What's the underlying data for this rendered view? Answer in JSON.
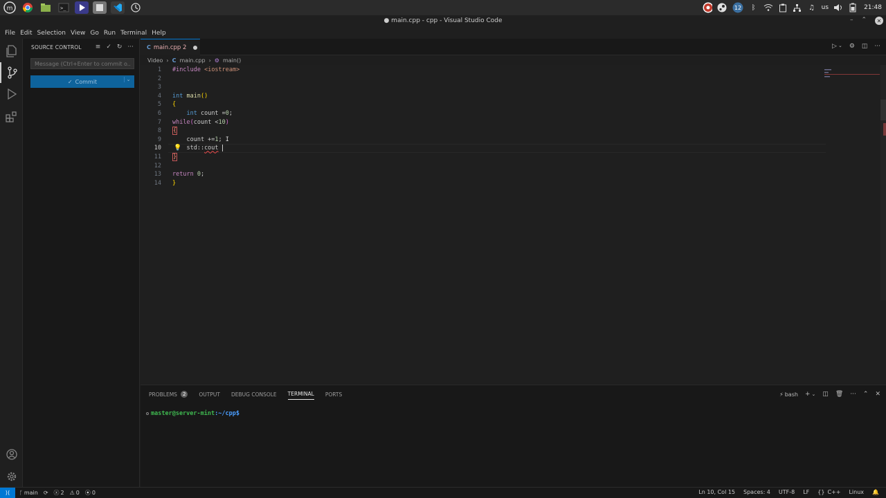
{
  "os": {
    "clock": "21:48",
    "keyboard": "us",
    "badge_count": "12"
  },
  "window": {
    "title": "● main.cpp - cpp - Visual Studio Code"
  },
  "menu": [
    "File",
    "Edit",
    "Selection",
    "View",
    "Go",
    "Run",
    "Terminal",
    "Help"
  ],
  "sidebar": {
    "title": "SOURCE CONTROL",
    "commit_placeholder": "Message (Ctrl+Enter to commit o...",
    "commit_label": "Commit"
  },
  "tab": {
    "label": "main.cpp 2"
  },
  "breadcrumb": [
    "Video",
    "main.cpp",
    "main()"
  ],
  "editor": {
    "lines": [
      "1",
      "2",
      "3",
      "4",
      "5",
      "6",
      "7",
      "8",
      "9",
      "10",
      "11",
      "12",
      "13",
      "14"
    ],
    "current_line": "10"
  },
  "panel": {
    "tabs": [
      "PROBLEMS",
      "OUTPUT",
      "DEBUG CONSOLE",
      "TERMINAL",
      "PORTS"
    ],
    "problems_count": "2",
    "active_tab": "TERMINAL",
    "shell": "bash",
    "prompt_user": "master@server-mint",
    "prompt_path": ":~/cpp$"
  },
  "status": {
    "branch": "main",
    "errors": "2",
    "warnings": "0",
    "ports": "0",
    "position": "Ln 10, Col 15",
    "spaces": "Spaces: 4",
    "encoding": "UTF-8",
    "eol": "LF",
    "language": "C++",
    "os": "Linux"
  }
}
